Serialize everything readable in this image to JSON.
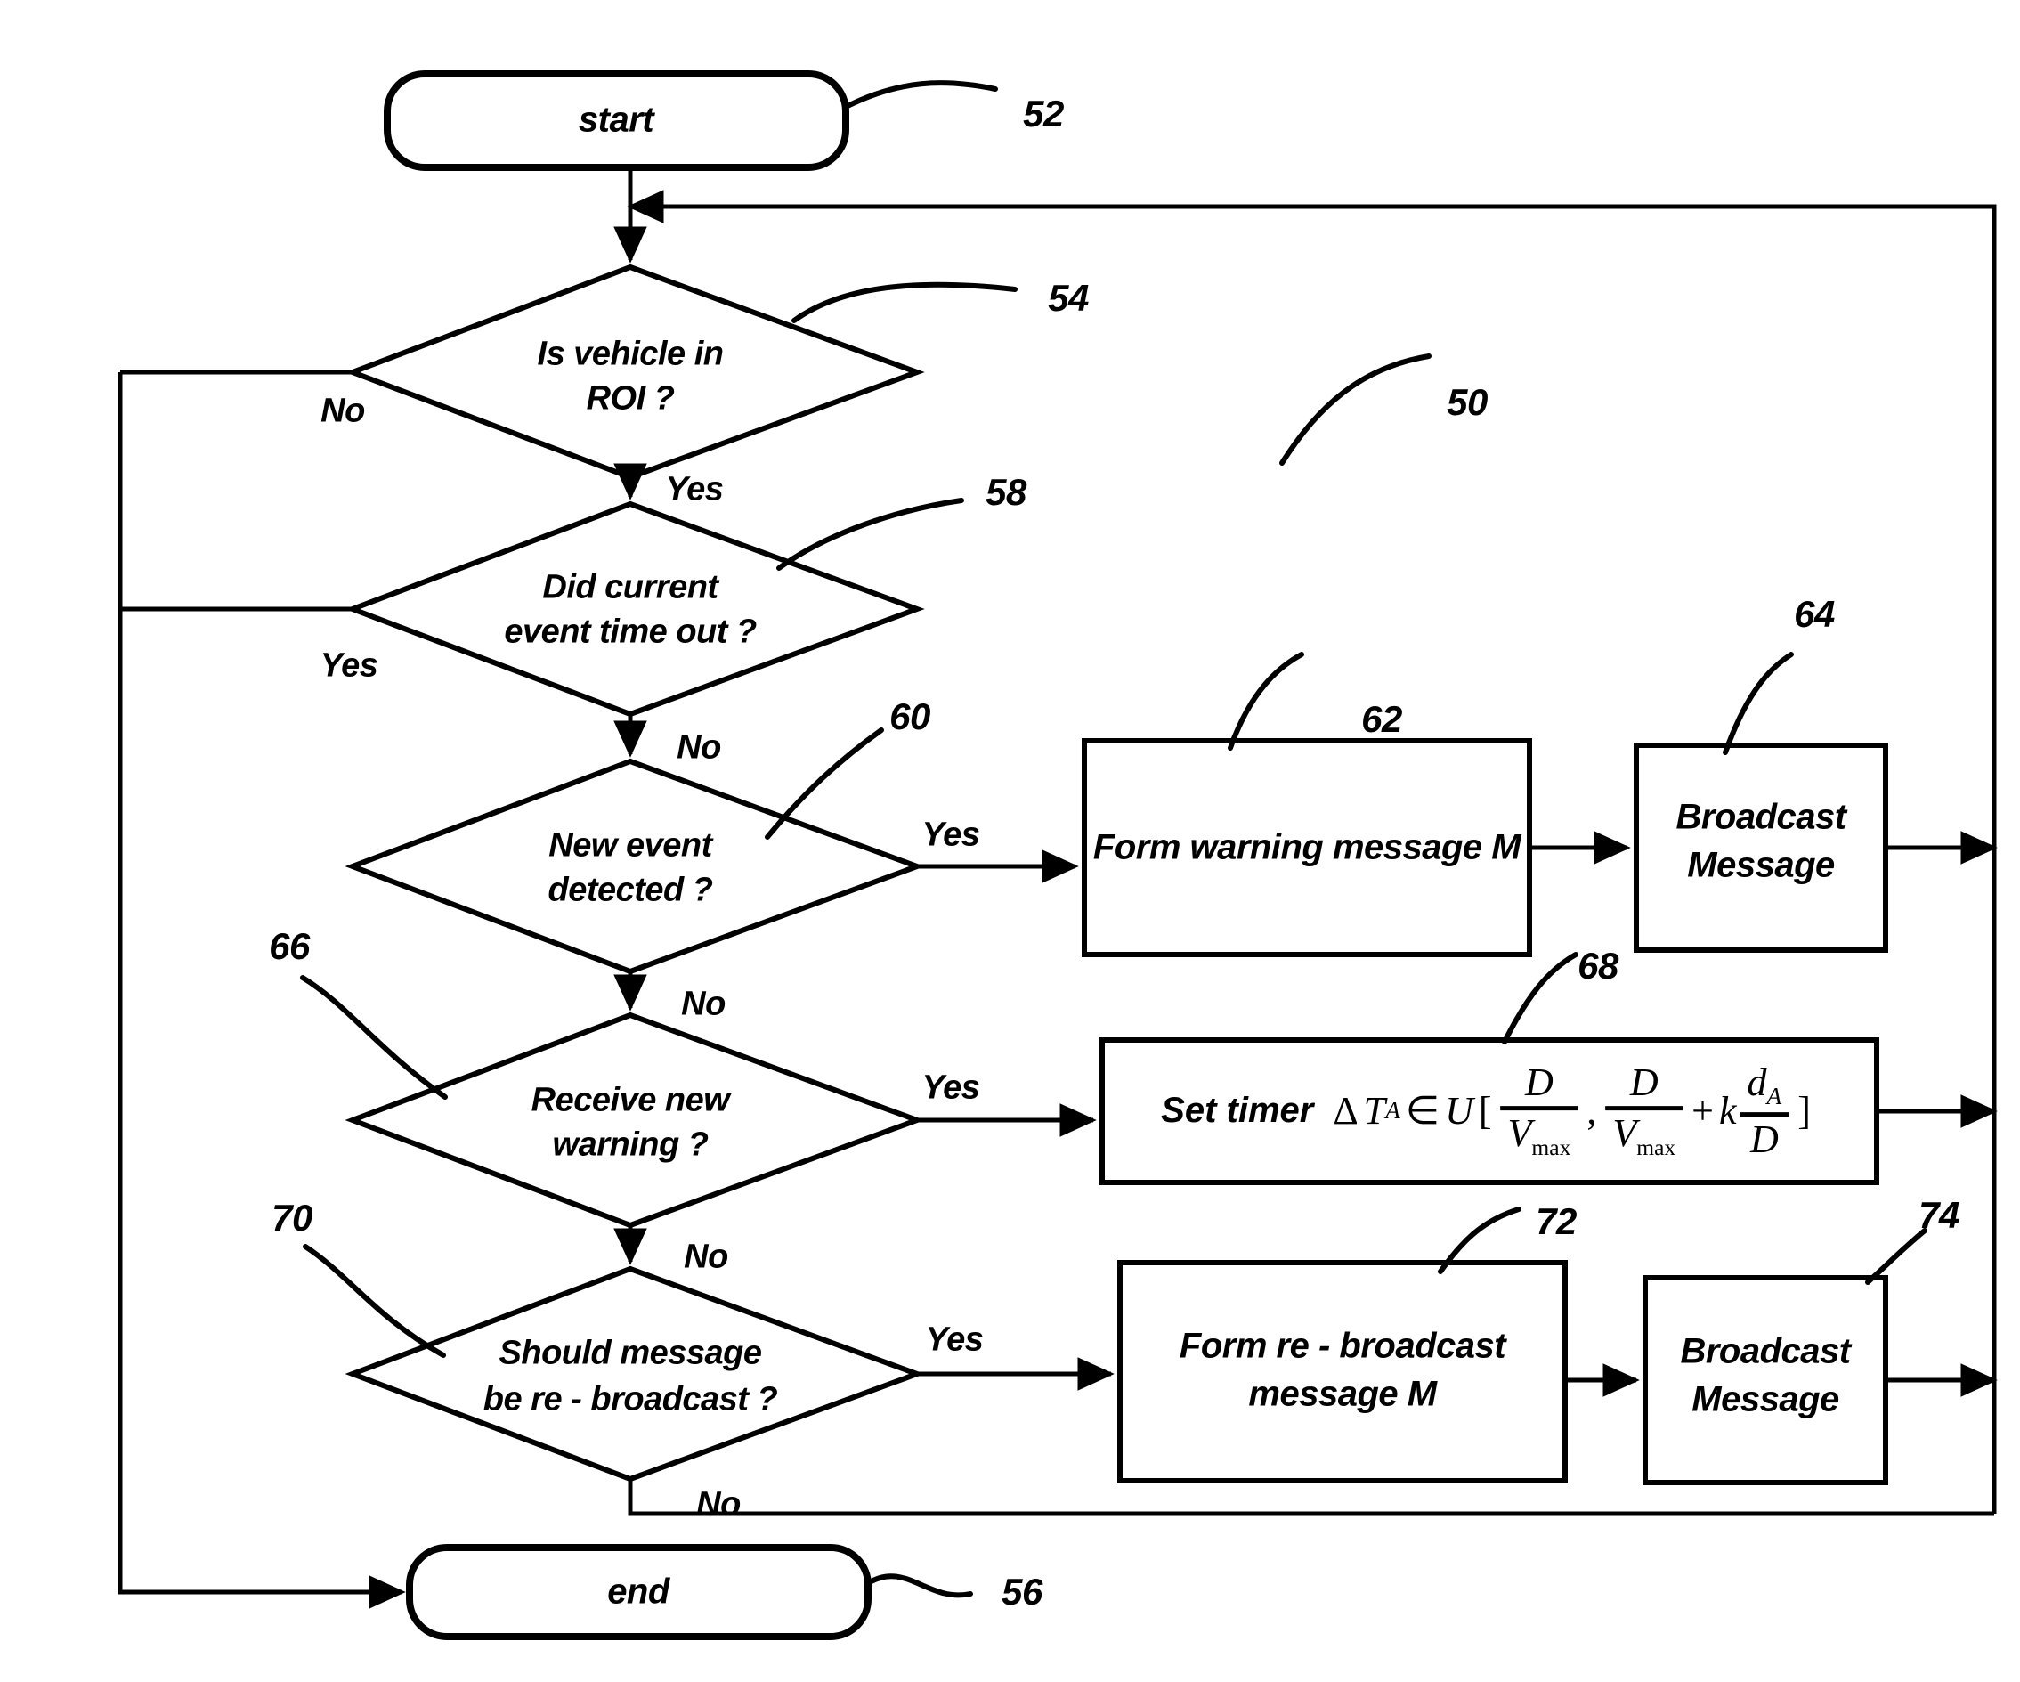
{
  "figure": {
    "title": "Vehicle warning message broadcast flowchart",
    "reference_numeral": "50",
    "line_color": "#000000",
    "background_color": "#ffffff"
  },
  "nodes": {
    "start": {
      "label": "start",
      "ref": "52",
      "type": "terminator"
    },
    "end": {
      "label": "end",
      "ref": "56",
      "type": "terminator"
    },
    "d_roi": {
      "line1": "Is vehicle in",
      "line2": "ROI ?",
      "ref": "54",
      "type": "decision"
    },
    "d_timeout": {
      "line1": "Did current",
      "line2": "event time out ?",
      "ref": "58",
      "type": "decision"
    },
    "d_newevent": {
      "line1": "New event",
      "line2": "detected ?",
      "ref": "60",
      "type": "decision"
    },
    "d_recvwarn": {
      "line1": "Receive new",
      "line2": "warning ?",
      "ref": "66",
      "type": "decision"
    },
    "d_rebroadcast": {
      "line1": "Should message",
      "line2": "be re - broadcast ?",
      "ref": "70",
      "type": "decision"
    },
    "p_formwarn": {
      "label": "Form warning message M",
      "ref": "62",
      "type": "process"
    },
    "p_broadcast1": {
      "line1": "Broadcast",
      "line2": "Message",
      "ref": "64",
      "type": "process"
    },
    "p_settimer": {
      "lead": "Set timer",
      "formula_plain": "ΔT_A ∈ U[ D/V_max , D/V_max + k d_A/D ]",
      "ref": "68",
      "type": "process",
      "math": {
        "delta": "Δ",
        "T": "T",
        "T_sub": "A",
        "in": "∈",
        "U": "U",
        "lbrack": "[",
        "frac1_num": "D",
        "frac1_den": "V",
        "frac1_den_sub": "max",
        "comma": ",",
        "frac2_num": "D",
        "frac2_den": "V",
        "frac2_den_sub": "max",
        "plus": "+",
        "k": "k",
        "frac3_num": "d",
        "frac3_num_sub": "A",
        "frac3_den": "D",
        "rbrack": "]"
      }
    },
    "p_formrebroad": {
      "line1": "Form re - broadcast",
      "line2": "message M",
      "ref": "72",
      "type": "process"
    },
    "p_broadcast2": {
      "line1": "Broadcast",
      "line2": "Message",
      "ref": "74",
      "type": "process"
    }
  },
  "branch_labels": {
    "roi_no": "No",
    "roi_yes": "Yes",
    "timeout_yes": "Yes",
    "timeout_no": "No",
    "newevent_yes": "Yes",
    "newevent_no": "No",
    "recvwarn_yes": "Yes",
    "recvwarn_no": "No",
    "rebroadcast_yes": "Yes",
    "rebroadcast_no": "No"
  },
  "reference_numerals": [
    "50",
    "52",
    "54",
    "56",
    "58",
    "60",
    "62",
    "64",
    "66",
    "68",
    "70",
    "72",
    "74"
  ]
}
